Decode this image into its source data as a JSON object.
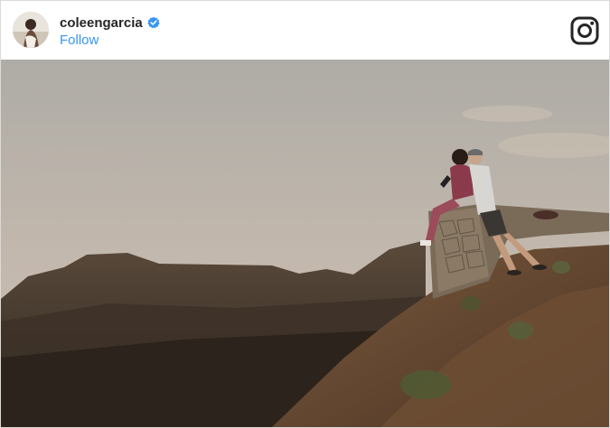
{
  "post": {
    "username": "coleengarcia",
    "verified": true,
    "follow_label": "Follow"
  },
  "icons": {
    "verified_badge": "verified-badge-icon",
    "logo": "instagram-logo-icon"
  },
  "colors": {
    "follow": "#3897f0",
    "verified": "#3897f0",
    "username": "#262626",
    "border": "#dbdbdb"
  }
}
